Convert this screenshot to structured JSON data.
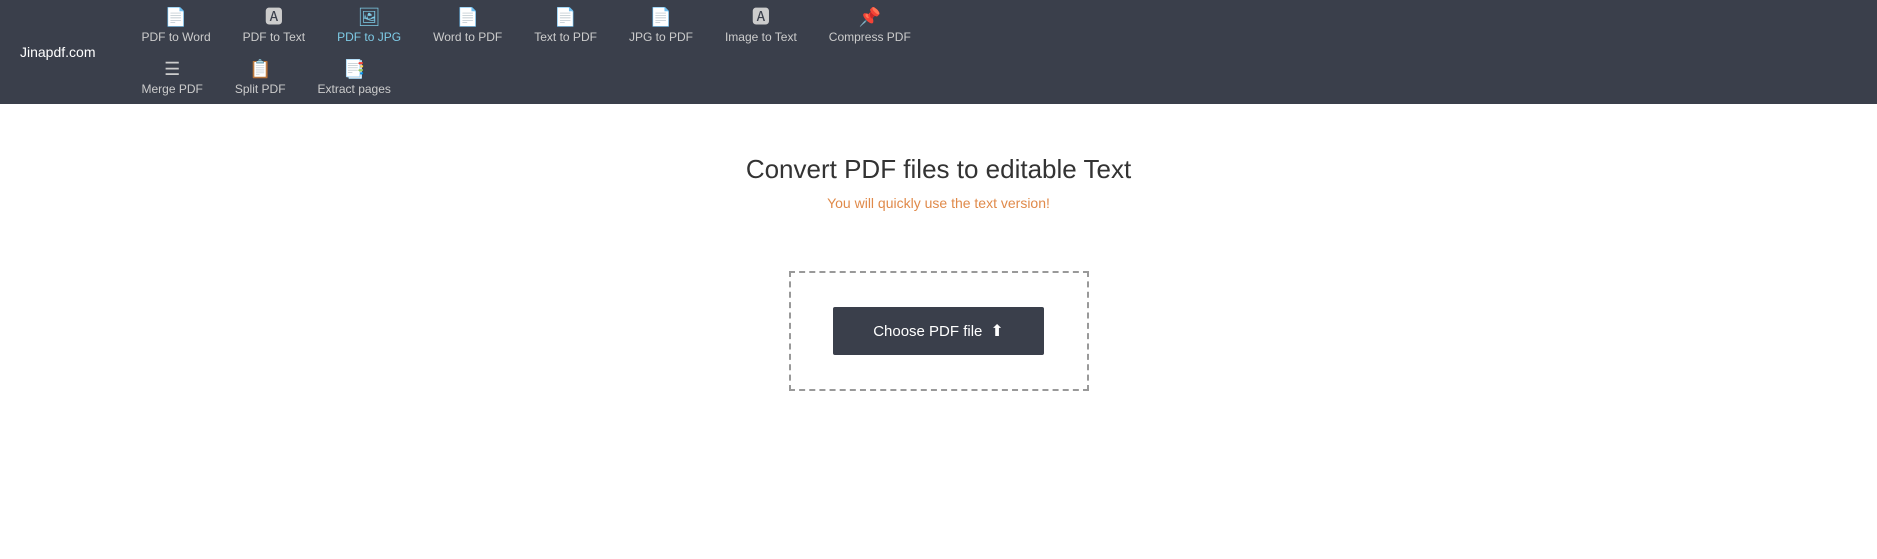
{
  "brand": {
    "label": "Jinapdf.com"
  },
  "nav": {
    "rows": [
      [
        {
          "id": "pdf-to-word",
          "label": "PDF to Word",
          "icon": "📄",
          "active": false
        },
        {
          "id": "pdf-to-text",
          "label": "PDF to Text",
          "icon": "🅰",
          "active": false
        },
        {
          "id": "pdf-to-jpg",
          "label": "PDF to JPG",
          "icon": "🖼",
          "active": true
        },
        {
          "id": "word-to-pdf",
          "label": "Word to PDF",
          "icon": "📄",
          "active": false
        },
        {
          "id": "text-to-pdf",
          "label": "Text to PDF",
          "icon": "📄",
          "active": false
        },
        {
          "id": "jpg-to-pdf",
          "label": "JPG to PDF",
          "icon": "📄",
          "active": false
        },
        {
          "id": "image-to-text",
          "label": "Image to Text",
          "icon": "🅰",
          "active": false
        },
        {
          "id": "compress-pdf",
          "label": "Compress PDF",
          "icon": "📌",
          "active": false
        }
      ],
      [
        {
          "id": "merge-pdf",
          "label": "Merge PDF",
          "icon": "☰",
          "active": false
        },
        {
          "id": "split-pdf",
          "label": "Split PDF",
          "icon": "📋",
          "active": false
        },
        {
          "id": "extract-pages",
          "label": "Extract pages",
          "icon": "📑",
          "active": false
        }
      ]
    ]
  },
  "main": {
    "title": "Convert PDF files to editable Text",
    "subtitle": "You will quickly use the text version!",
    "choose_btn_label": "Choose PDF file",
    "choose_btn_icon": "⬆"
  }
}
